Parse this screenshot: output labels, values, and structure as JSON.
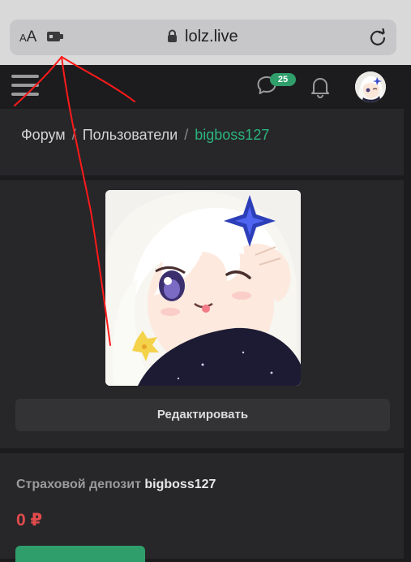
{
  "browser": {
    "text_size_label_small": "A",
    "text_size_label_large": "A",
    "url": "lolz.live"
  },
  "header": {
    "messages_count": "25"
  },
  "breadcrumb": {
    "items": [
      "Форум",
      "Пользователи",
      "bigboss127"
    ],
    "separator": "/"
  },
  "profile": {
    "edit_label": "Редактировать"
  },
  "deposit": {
    "title": "Страховой депозит",
    "username": "bigboss127",
    "amount": "0 ₽"
  },
  "colors": {
    "accent_green": "#2bb57c",
    "deposit_red": "#e14b4b",
    "annotation_red": "#ff1a1a"
  }
}
